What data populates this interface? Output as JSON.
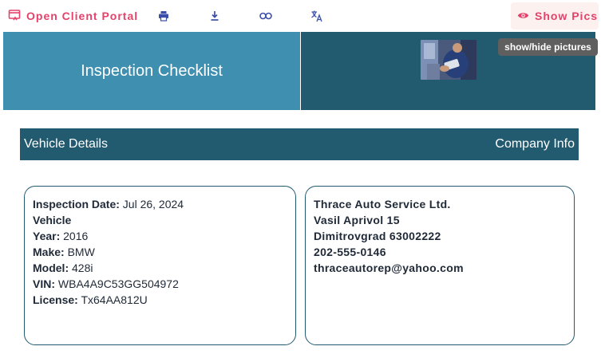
{
  "toolbar": {
    "portal_label": "Open Client Portal",
    "portal_icon": "open-in-browser-icon",
    "print_icon": "print-icon",
    "download_icon": "download-icon",
    "link_icon": "link-icon",
    "translate_icon": "translate-icon",
    "show_pics_label": "Show Pics",
    "show_pics_icon": "eye-icon",
    "accent_color": "#e4426a"
  },
  "tooltip": {
    "text": "show/hide pictures"
  },
  "banner": {
    "title": "Inspection Checklist",
    "left_color": "#3f8fb0",
    "right_color": "#225a70"
  },
  "section": {
    "left_label": "Vehicle Details",
    "right_label": "Company Info"
  },
  "vehicle": {
    "inspection_date_label": "Inspection Date:",
    "inspection_date": "Jul 26, 2024",
    "heading": "Vehicle",
    "year_label": "Year:",
    "year": "2016",
    "make_label": "Make:",
    "make": "BMW",
    "model_label": "Model:",
    "model": "428i",
    "vin_label": "VIN:",
    "vin": "WBA4A9C53GG504972",
    "license_label": "License:",
    "license": "Tx64AA812U"
  },
  "company": {
    "name": "Thrace Auto Service Ltd.",
    "street": "Vasil Aprivol 15",
    "city": "Dimitrovgrad 63002222",
    "phone": "202-555-0146",
    "email": "thraceautorep@yahoo.com"
  }
}
